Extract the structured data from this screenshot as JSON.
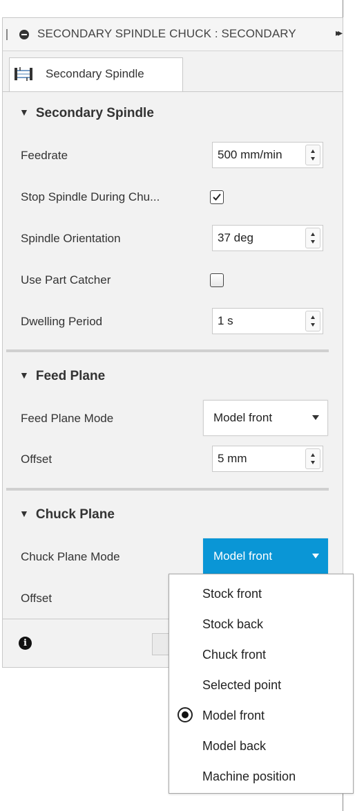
{
  "panel": {
    "title": "SECONDARY SPINDLE CHUCK : SECONDARY",
    "collapse_glyph": "▸▸",
    "tab_label": "Secondary Spindle"
  },
  "secondary_spindle": {
    "header": "Secondary Spindle",
    "feedrate": {
      "label": "Feedrate",
      "value": "500 mm/min"
    },
    "stop_spindle": {
      "label": "Stop Spindle During Chu...",
      "checked": true
    },
    "spindle_orientation": {
      "label": "Spindle Orientation",
      "value": "37 deg"
    },
    "use_part_catcher": {
      "label": "Use Part Catcher",
      "checked": false
    },
    "dwelling_period": {
      "label": "Dwelling Period",
      "value": "1 s"
    }
  },
  "feed_plane": {
    "header": "Feed Plane",
    "mode": {
      "label": "Feed Plane Mode",
      "value": "Model front"
    },
    "offset": {
      "label": "Offset",
      "value": "5 mm"
    }
  },
  "chuck_plane": {
    "header": "Chuck Plane",
    "mode": {
      "label": "Chuck Plane Mode",
      "value": "Model front"
    },
    "offset": {
      "label": "Offset"
    }
  },
  "footer": {
    "info_glyph": "i"
  },
  "dropdown": {
    "options": [
      "Stock front",
      "Stock back",
      "Chuck front",
      "Selected point",
      "Model front",
      "Model back",
      "Machine position"
    ],
    "selected": "Model front"
  },
  "colors": {
    "accent": "#0a96d6",
    "panel_bg": "#f2f2f2"
  },
  "icons": {
    "title": "minus-circle-icon",
    "tab": "spindle-icon",
    "info": "info-icon",
    "selected": "radio-selected-icon"
  }
}
